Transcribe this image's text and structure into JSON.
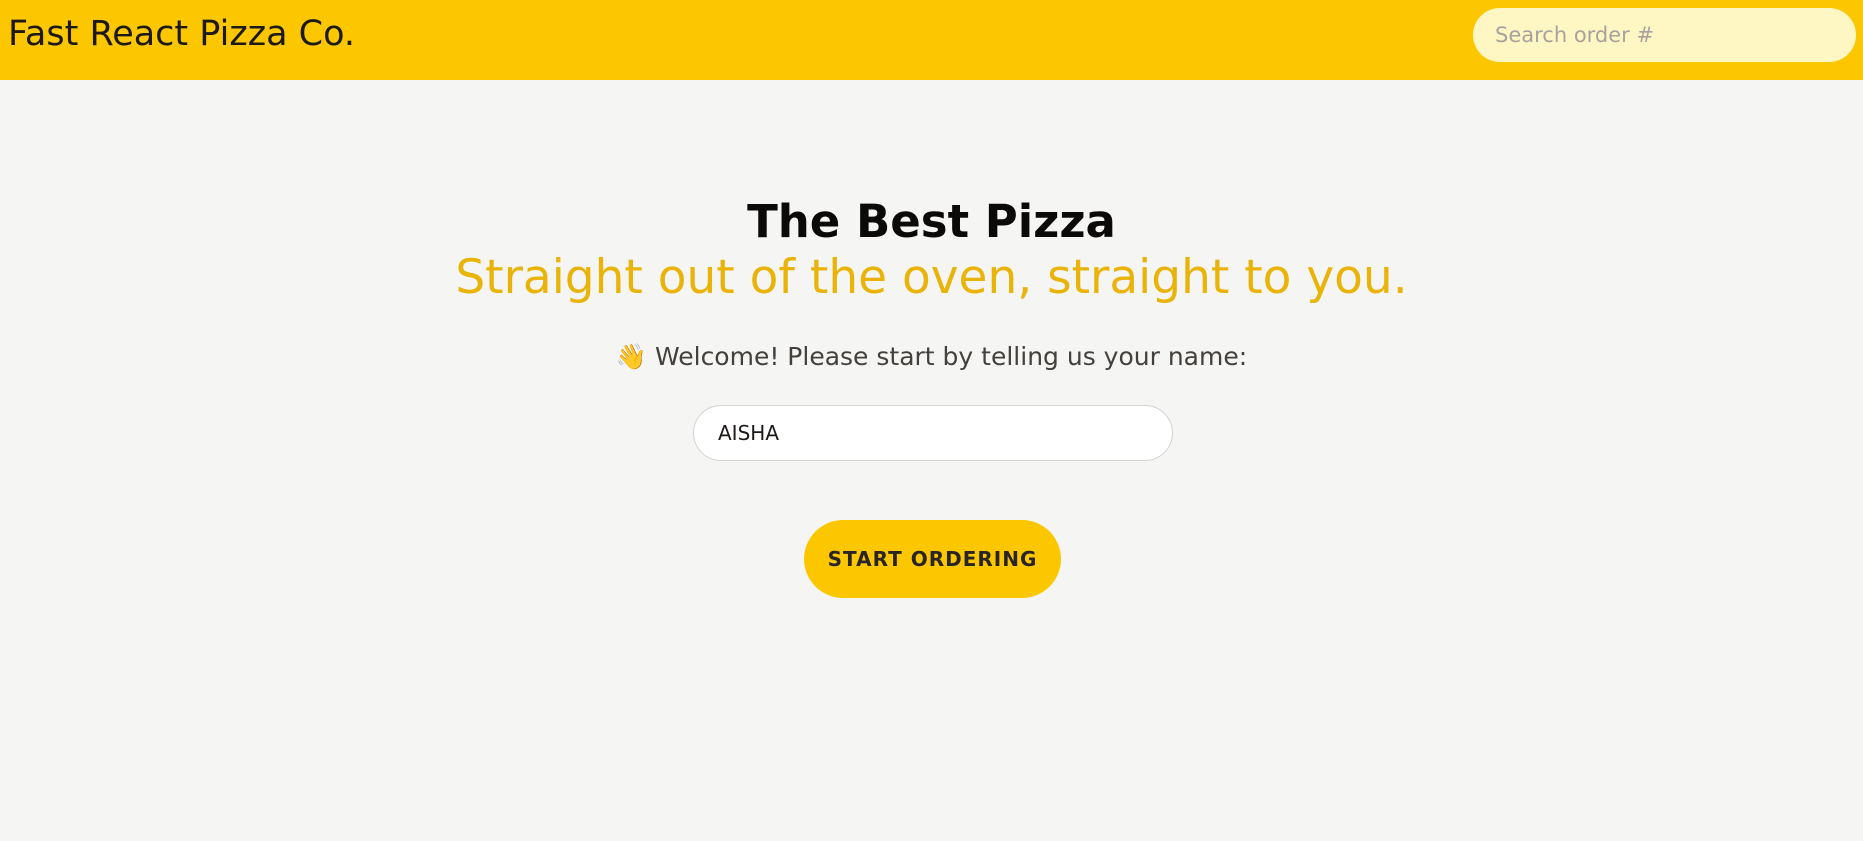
{
  "header": {
    "brand": "Fast React Pizza Co.",
    "search_placeholder": "Search order #",
    "background_color": "#fdc700"
  },
  "home": {
    "title": "The Best Pizza",
    "subtitle": "Straight out of the oven, straight to you.",
    "welcome_icon": "waving-hand-icon",
    "welcome_emoji": "👋",
    "welcome_text": "Welcome! Please start by telling us your name:",
    "name_value": "AISHA",
    "start_button_label": "START ORDERING",
    "accent_color": "#eab308"
  }
}
